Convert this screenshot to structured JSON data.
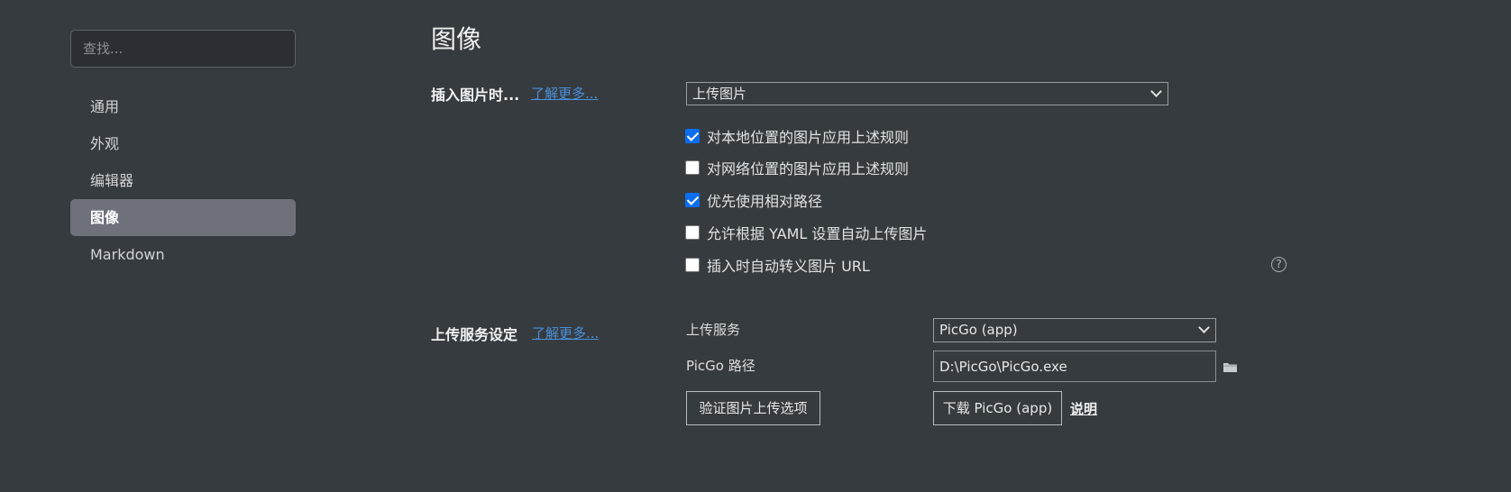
{
  "sidebar": {
    "search_placeholder": "查找...",
    "items": [
      {
        "label": "通用"
      },
      {
        "label": "外观"
      },
      {
        "label": "编辑器"
      },
      {
        "label": "图像",
        "active": true
      },
      {
        "label": "Markdown"
      }
    ]
  },
  "main": {
    "title": "图像",
    "insert_section": {
      "label": "插入图片时...",
      "learn_more": "了解更多...",
      "select_value": "上传图片",
      "checkboxes": [
        {
          "label": "对本地位置的图片应用上述规则",
          "checked": true
        },
        {
          "label": "对网络位置的图片应用上述规则",
          "checked": false
        },
        {
          "label": "优先使用相对路径",
          "checked": true
        },
        {
          "label": "允许根据 YAML 设置自动上传图片",
          "checked": false
        },
        {
          "label": "插入时自动转义图片 URL",
          "checked": false
        }
      ],
      "help_icon": "question-circle-icon"
    },
    "upload_section": {
      "label": "上传服务设定",
      "learn_more": "了解更多...",
      "service_label": "上传服务",
      "service_value": "PicGo (app)",
      "path_label": "PicGo 路径",
      "path_value": "D:\\PicGo\\PicGo.exe",
      "folder_icon": "folder-icon",
      "verify_button": "验证图片上传选项",
      "download_button": "下载 PicGo (app)",
      "explain_link": "说明"
    }
  },
  "colors": {
    "background": "#363b40",
    "active_nav": "#6e717a",
    "link": "#4a90d9",
    "checkbox_checked": "#0b6ef0"
  }
}
